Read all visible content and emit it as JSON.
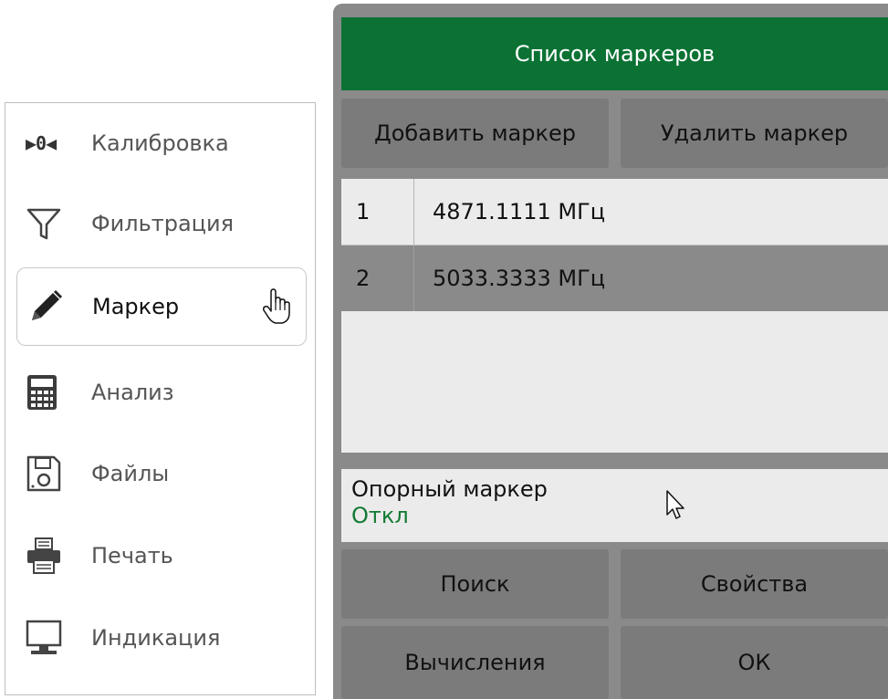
{
  "left_menu": {
    "items": [
      {
        "label": "Калибровка",
        "icon": "calibration-icon",
        "icon_glyph": "▶0◀"
      },
      {
        "label": "Фильтрация",
        "icon": "filter-icon"
      },
      {
        "label": "Маркер",
        "icon": "pencil-icon",
        "active": true
      },
      {
        "label": "Анализ",
        "icon": "calculator-icon"
      },
      {
        "label": "Файлы",
        "icon": "floppy-disk-icon"
      },
      {
        "label": "Печать",
        "icon": "printer-icon"
      },
      {
        "label": "Индикация",
        "icon": "monitor-icon"
      }
    ]
  },
  "panel": {
    "title": "Список маркеров",
    "add_marker": "Добавить маркер",
    "delete_marker": "Удалить маркер",
    "markers": [
      {
        "num": "1",
        "value": "4871.1111  МГц",
        "selected": false
      },
      {
        "num": "2",
        "value": "5033.3333  МГц",
        "selected": true
      }
    ],
    "reference_marker": {
      "label": "Опорный маркер",
      "value": "Откл"
    },
    "search": "Поиск",
    "properties": "Свойства",
    "calculations": "Вычисления",
    "ok": "ОК"
  },
  "colors": {
    "title_bar": "#0b7234",
    "panel_bg": "#8a8a8a",
    "button_bg": "#7b7b7b",
    "list_bg": "#ebebeb",
    "selected_row": "#8a8a8a",
    "ref_value_text": "#107a32"
  }
}
